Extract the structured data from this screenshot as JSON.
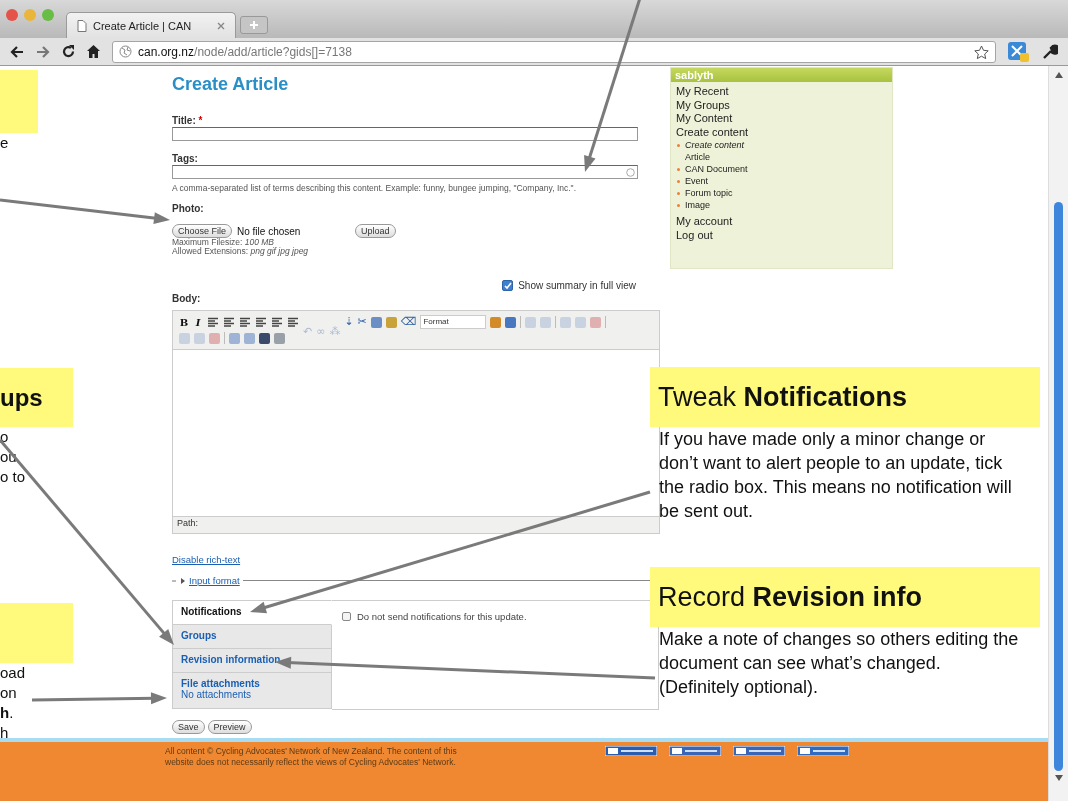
{
  "browser": {
    "tab_title": "Create Article | CAN",
    "url_host": "can.org.nz",
    "url_path": "/node/add/article?gids[]=7138"
  },
  "page": {
    "heading": "Create Article",
    "title_field": {
      "label": "Title:",
      "required_mark": "*"
    },
    "tags_field": {
      "label": "Tags:",
      "help": "A comma-separated list of terms describing this content. Example: funny, bungee jumping, \"Company, Inc.\"."
    },
    "photo": {
      "label": "Photo:",
      "choose_button": "Choose File",
      "file_status": "No file chosen",
      "upload_button": "Upload",
      "max_size": "Maximum Filesize: *100 MB*",
      "extensions": "Allowed Extensions: *png gif jpg jpeg*"
    },
    "summary_toggle": {
      "label": "Show summary in full view",
      "checked": true
    },
    "body": {
      "label": "Body:",
      "path_label": "Path:",
      "toolbar_rows": [
        [
          {
            "kind": "text",
            "label": "B"
          },
          {
            "kind": "text",
            "label": "I",
            "italic": true
          },
          {
            "kind": "lines"
          },
          {
            "kind": "lines"
          },
          {
            "kind": "lines"
          },
          {
            "kind": "lines"
          },
          {
            "kind": "lines"
          },
          {
            "kind": "lines"
          },
          {
            "kind": "glyph",
            "label": "↶",
            "disabled": true
          },
          {
            "kind": "glyph",
            "label": "∞",
            "disabled": true
          },
          {
            "kind": "glyph",
            "label": "⁂",
            "disabled": true
          },
          {
            "kind": "glyph",
            "label": "⇣",
            "disabled": false
          },
          {
            "kind": "glyph",
            "label": "✂",
            "disabled": false
          },
          {
            "kind": "block",
            "color": "#6b8fc4"
          },
          {
            "kind": "block",
            "color": "#c9a23a"
          },
          {
            "kind": "glyph",
            "label": "⌫",
            "disabled": false
          },
          {
            "kind": "select",
            "label": "Format"
          },
          {
            "kind": "block",
            "color": "#d38b2a"
          },
          {
            "kind": "block",
            "color": "#4a78c0"
          },
          {
            "kind": "sep"
          },
          {
            "kind": "block",
            "color": "#c8d2e0"
          },
          {
            "kind": "block",
            "color": "#c8d2e0"
          },
          {
            "kind": "sep"
          },
          {
            "kind": "block",
            "color": "#c8d2e0"
          },
          {
            "kind": "block",
            "color": "#c8d2e0"
          },
          {
            "kind": "block",
            "color": "#e0b0b0"
          },
          {
            "kind": "sep"
          }
        ],
        [
          {
            "kind": "block",
            "color": "#c8d2e0"
          },
          {
            "kind": "block",
            "color": "#c8d2e0"
          },
          {
            "kind": "block",
            "color": "#e0b0b0"
          },
          {
            "kind": "sep"
          },
          {
            "kind": "block",
            "color": "#9fb3d6"
          },
          {
            "kind": "block",
            "color": "#9fb3d6"
          },
          {
            "kind": "block",
            "color": "#3a4a6a"
          },
          {
            "kind": "block",
            "color": "#9aa0a8"
          }
        ]
      ]
    },
    "disable_link": "Disable rich-text",
    "input_format": "Input format",
    "vertical_tabs": [
      {
        "title": "Notifications",
        "selected": true
      },
      {
        "title": "Groups",
        "selected": false
      },
      {
        "title": "Revision information",
        "selected": false
      },
      {
        "title": "File attachments",
        "summary": "No attachments",
        "selected": false
      }
    ],
    "notifications_option": {
      "label": "Do not send notifications for this update.",
      "checked": false
    },
    "buttons": [
      "Save",
      "Preview"
    ]
  },
  "sidebar": {
    "header": "sablyth",
    "items": [
      {
        "label": "My Recent"
      },
      {
        "label": "My Groups"
      },
      {
        "label": "My Content"
      },
      {
        "label": "Create content",
        "children": [
          {
            "label": "Create content",
            "expanded": true,
            "children": [
              {
                "label": "Article"
              }
            ]
          },
          {
            "label": "CAN Document",
            "expanded": false
          },
          {
            "label": "Event",
            "expanded": false
          },
          {
            "label": "Forum topic",
            "expanded": false
          },
          {
            "label": "Image",
            "expanded": false
          }
        ]
      },
      {
        "label": "My account"
      },
      {
        "label": "Log out"
      }
    ]
  },
  "footer": {
    "text": "All content © Cycling Advocates' Network of New Zealand. The content of this website does not necessarily reflect the views of Cycling Advocates' Network.",
    "badges": [
      {
        "kind": "egressive"
      },
      {
        "kind": "w3c"
      },
      {
        "kind": "w3c"
      },
      {
        "kind": "drupal"
      }
    ]
  },
  "callouts": [
    {
      "title": "Tweak **Notifications**",
      "text": "If you have made only a minor change or don’t want to alert people to an update, tick the radio box. This means no notification will be sent out."
    },
    {
      "title": "Record **Revision info**",
      "text": "Make a note of changes so others editing the document can see what’s changed. (Definitely optional)."
    }
  ],
  "cut_callouts": [
    {
      "lines": [
        "e"
      ]
    },
    {
      "title": "ups",
      "lines": [
        "o",
        "ou",
        "o to"
      ]
    },
    {
      "lines": [
        "oad",
        "on",
        "**h**.",
        "h"
      ]
    }
  ]
}
